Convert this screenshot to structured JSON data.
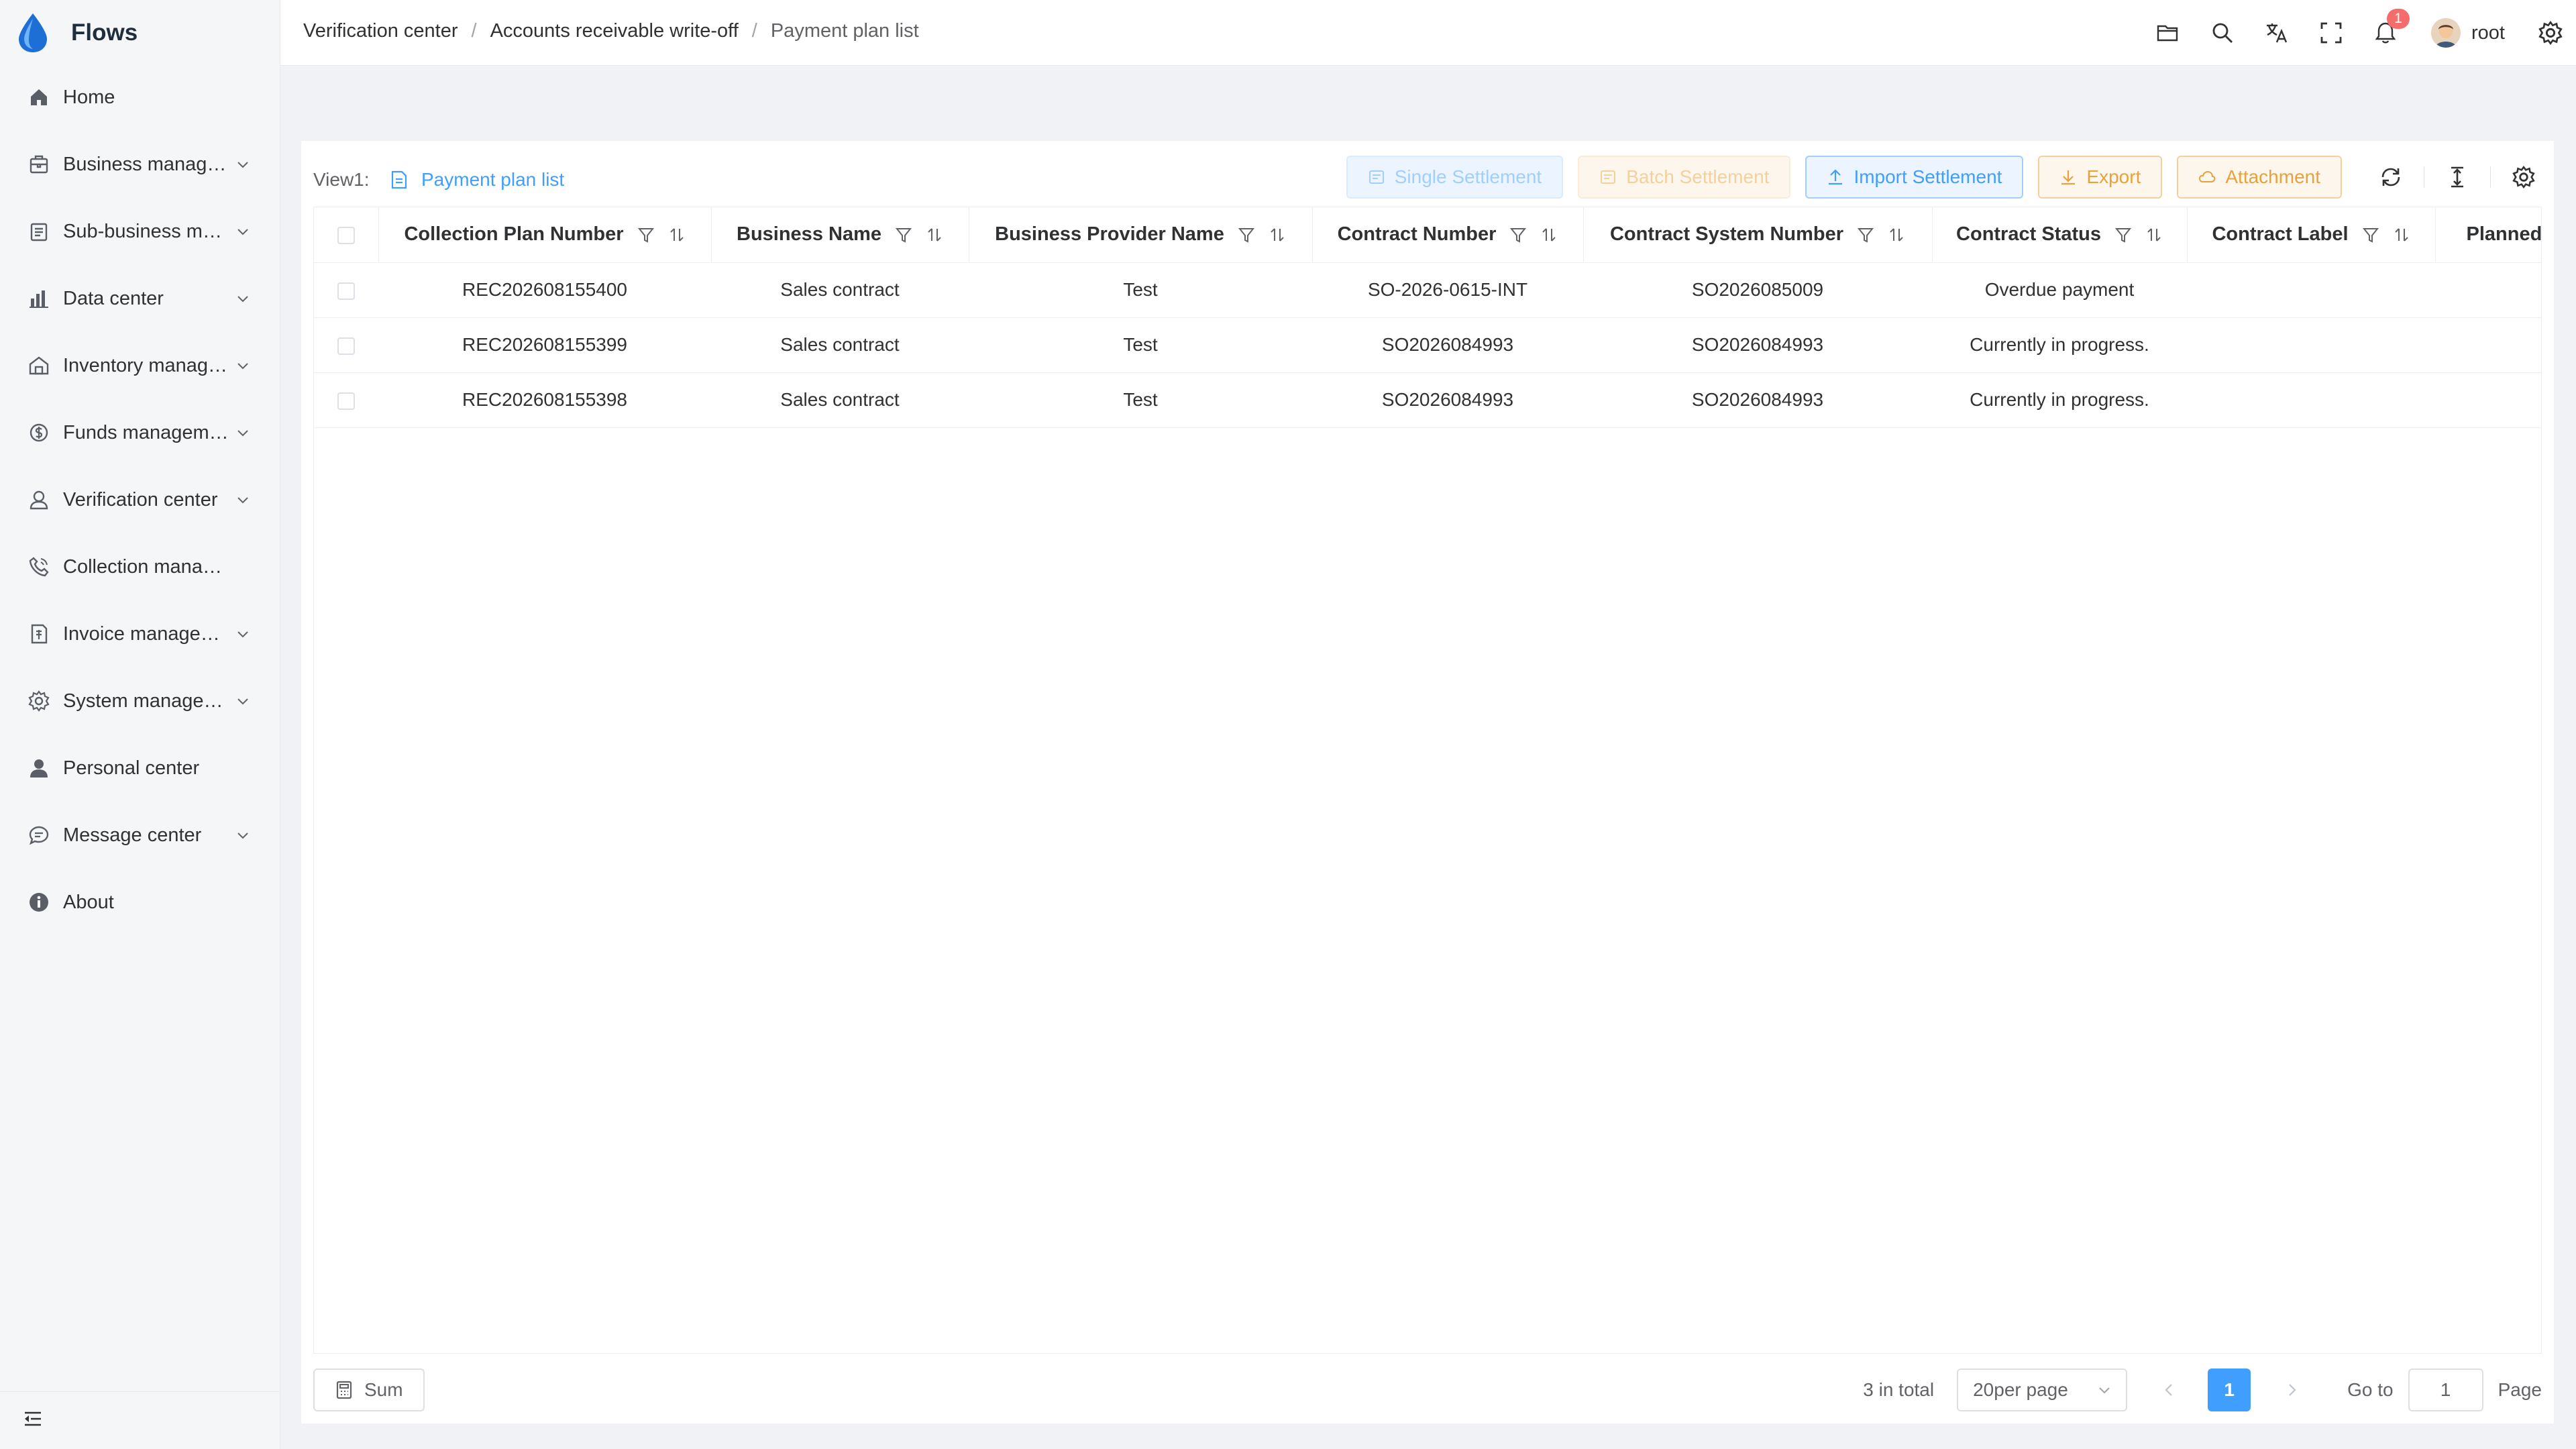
{
  "app": {
    "name": "Flows"
  },
  "sidebar": {
    "items": [
      {
        "label": "Home",
        "icon": "home-icon",
        "expandable": false
      },
      {
        "label": "Business management",
        "icon": "briefcase-icon",
        "expandable": true
      },
      {
        "label": "Sub-business management",
        "icon": "clipboard-icon",
        "expandable": true
      },
      {
        "label": "Data center",
        "icon": "bar-chart-icon",
        "expandable": true
      },
      {
        "label": "Inventory management",
        "icon": "warehouse-icon",
        "expandable": true
      },
      {
        "label": "Funds management",
        "icon": "funds-icon",
        "expandable": true
      },
      {
        "label": "Verification center",
        "icon": "user-check-icon",
        "expandable": true
      },
      {
        "label": "Collection management",
        "icon": "phone-icon",
        "expandable": false
      },
      {
        "label": "Invoice management",
        "icon": "invoice-icon",
        "expandable": true
      },
      {
        "label": "System management",
        "icon": "gear-icon",
        "expandable": true
      },
      {
        "label": "Personal center",
        "icon": "person-icon",
        "expandable": false
      },
      {
        "label": "Message center",
        "icon": "message-icon",
        "expandable": true
      },
      {
        "label": "About",
        "icon": "info-icon",
        "expandable": false
      }
    ]
  },
  "header": {
    "breadcrumb": [
      "Verification center",
      "Accounts receivable write-off",
      "Payment plan list"
    ],
    "notification_count": "1",
    "username": "root"
  },
  "toolbar": {
    "view_label": "View1:",
    "view_tab": "Payment plan list",
    "single_settlement": "Single Settlement",
    "batch_settlement": "Batch Settlement",
    "import_settlement": "Import Settlement",
    "export": "Export",
    "attachment": "Attachment"
  },
  "table": {
    "columns": [
      "Collection Plan Number",
      "Business Name",
      "Business Provider Name",
      "Contract Number",
      "Contract System Number",
      "Contract Status",
      "Contract Label",
      "Planned"
    ],
    "rows": [
      [
        "REC202608155400",
        "Sales contract",
        "Test",
        "SO-2026-0615-INT",
        "SO2026085009",
        "Overdue payment",
        ""
      ],
      [
        "REC202608155399",
        "Sales contract",
        "Test",
        "SO2026084993",
        "SO2026084993",
        "Currently in progress.",
        ""
      ],
      [
        "REC202608155398",
        "Sales contract",
        "Test",
        "SO2026084993",
        "SO2026084993",
        "Currently in progress.",
        ""
      ]
    ]
  },
  "footer": {
    "sum_label": "Sum",
    "total_text": "3 in total",
    "page_size": "20per page",
    "current_page": "1",
    "goto_label": "Go to",
    "goto_value": "1",
    "page_label": "Page"
  },
  "colors": {
    "primary": "#409eff",
    "warning": "#e6a23c",
    "badge": "#f56c6c"
  }
}
